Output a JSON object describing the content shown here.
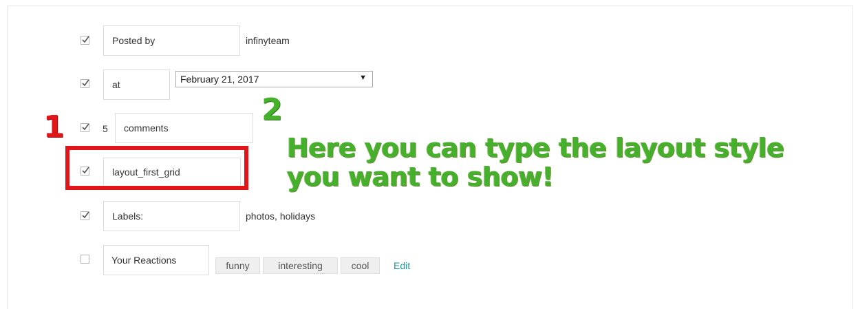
{
  "rows": {
    "posted_by": {
      "checked": true,
      "field_value": "Posted by",
      "author": "infinyteam"
    },
    "at": {
      "checked": true,
      "field_value": "at",
      "date_selected": "February 21, 2017"
    },
    "comments": {
      "checked": true,
      "count": "5",
      "field_value": "comments"
    },
    "layout": {
      "checked": true,
      "field_value": "layout_first_grid"
    },
    "labels": {
      "checked": true,
      "field_value": "Labels:",
      "label_values": "photos, holidays"
    },
    "reactions": {
      "checked": false,
      "field_value": "Your Reactions",
      "tags": [
        "funny",
        "interesting",
        "cool"
      ],
      "edit_label": "Edit"
    }
  },
  "annotations": {
    "marker_1": "1",
    "marker_2": "2",
    "hint_text": "Here you can type the layout style you want to show!",
    "marker_1_color": "#e0161b",
    "marker_2_color": "#44b02c",
    "highlight_color": "#e0161b"
  },
  "colors": {
    "link": "#1a9b9b",
    "hint_green": "#44b02c"
  }
}
